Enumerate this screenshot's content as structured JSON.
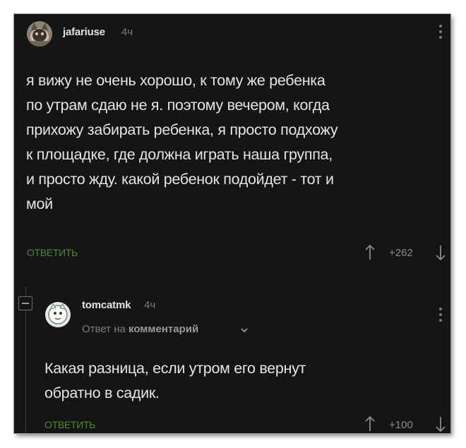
{
  "comment": {
    "username": "jafariuse",
    "time": "4ч",
    "text_lines": [
      "я вижу не очень хорошо, к тому же ребенка",
      "по утрам сдаю не я. поэтому вечером, когда",
      "прихожу забирать ребенка, я просто подхожу",
      "к площадке, где должна играть наша группа,",
      "и просто жду. какой ребенок подойдет - тот и",
      "мой"
    ],
    "reply_label": "ОТВЕТИТЬ",
    "rating": "+262"
  },
  "reply": {
    "username": "tomcatmk",
    "time": "4ч",
    "reply_to_prefix": "Ответ на",
    "reply_to_target": "комментарий",
    "text_lines": [
      "Какая разница, если утром его вернут",
      "обратно в садик."
    ],
    "reply_label": "ОТВЕТИТЬ",
    "rating": "+100"
  },
  "colors": {
    "background": "#151515",
    "text": "#e4e4e4",
    "muted": "#7d7d7d",
    "accent_green": "#4f8a2a"
  },
  "icons": {
    "upvote": "arrow-up-icon",
    "downvote": "arrow-down-icon",
    "menu": "vertical-dots-icon",
    "collapse": "minus-box-icon",
    "expand": "chevron-down-icon"
  }
}
